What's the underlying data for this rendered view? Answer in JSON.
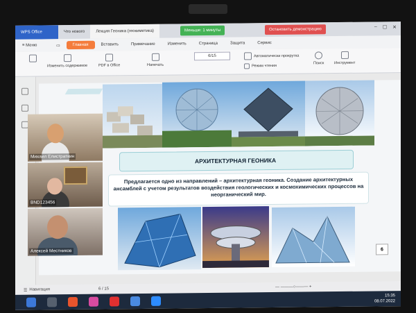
{
  "titlebar": {
    "app_name": "WPS Office",
    "tab_new": "Что нового",
    "doc_tab": "Лекция Геоника (геокиметика)",
    "timer": "Меньше: 1 минуты",
    "stop_button": "Остановить демонстрацию"
  },
  "menubar": {
    "menu_label": "Меню",
    "items": [
      "Главная",
      "Вставить",
      "Примечание",
      "Изменить",
      "Страница",
      "Защита",
      "Сервис"
    ]
  },
  "toolbar": {
    "edit_content": "Изменить содержимое",
    "pdf_to_office": "PDF в Office",
    "print": "Напечать",
    "page_indicator": "6/15",
    "autoplay": "Автоматически прокрутка",
    "reading_mode": "Режим чтения",
    "search": "Поиск",
    "tools": "Инструмент"
  },
  "slide": {
    "title": "АРХИТЕКТУРНАЯ ГЕОНИКА",
    "description": "Предлагается одно из направлений – архитектурная геоника. Создание архитектурных ансамблей с учетом результатов воздействия геологических и космохимических процессов на неорганический мир.",
    "number": "6"
  },
  "participants": [
    {
      "name": "Михаил Елистраткин"
    },
    {
      "name": "BND123456"
    },
    {
      "name": "Алексей Местников"
    }
  ],
  "statusbar": {
    "label": "Навигация",
    "page": "6 / 15"
  },
  "taskbar": {
    "time": "15:35",
    "date": "08.07.2022"
  }
}
